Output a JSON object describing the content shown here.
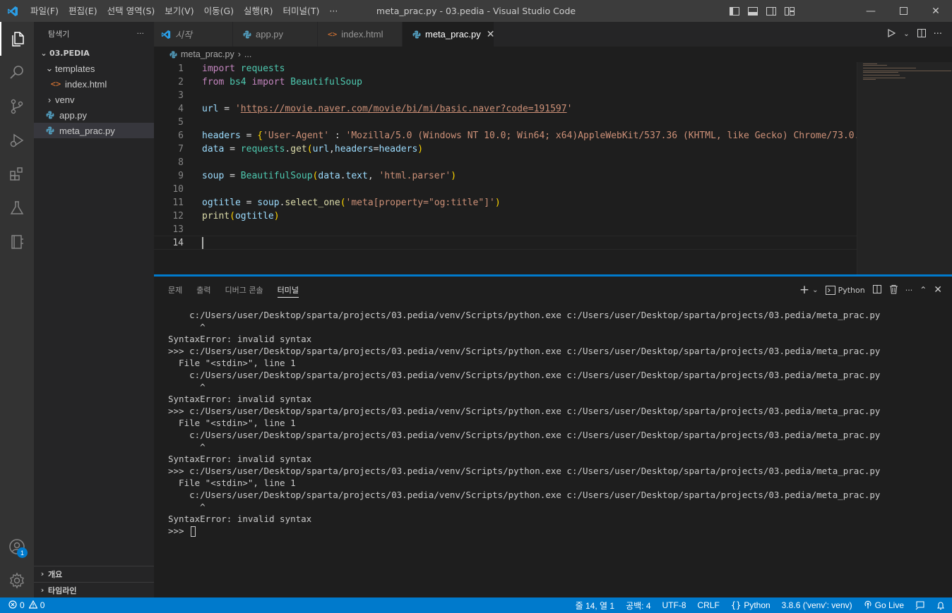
{
  "window": {
    "title": "meta_prac.py - 03.pedia - Visual Studio Code",
    "menu": [
      "파일(F)",
      "편집(E)",
      "선택 영역(S)",
      "보기(V)",
      "이동(G)",
      "실행(R)",
      "터미널(T)",
      "···"
    ]
  },
  "sidebar": {
    "header": "탐색기",
    "more": "···",
    "folder": "03.PEDIA",
    "tree": [
      {
        "label": "templates",
        "kind": "folder-open"
      },
      {
        "label": "index.html",
        "kind": "html"
      },
      {
        "label": "venv",
        "kind": "folder-closed"
      },
      {
        "label": "app.py",
        "kind": "python"
      },
      {
        "label": "meta_prac.py",
        "kind": "python",
        "selected": true
      }
    ],
    "outline": "개요",
    "timeline": "타임라인"
  },
  "tabs": [
    {
      "label": "시작",
      "icon": "vscode-icon"
    },
    {
      "label": "app.py",
      "icon": "python-icon"
    },
    {
      "label": "index.html",
      "icon": "html-icon"
    },
    {
      "label": "meta_prac.py",
      "icon": "python-icon",
      "active": true
    }
  ],
  "breadcrumb": {
    "file": "meta_prac.py",
    "sep": "›",
    "more": "..."
  },
  "editor": {
    "line_numbers": [
      "1",
      "2",
      "3",
      "4",
      "5",
      "6",
      "7",
      "8",
      "9",
      "10",
      "11",
      "12",
      "13",
      "14"
    ],
    "current_line": 14
  },
  "panel": {
    "tabs": [
      "문제",
      "출력",
      "디버그 콘솔",
      "터미널"
    ],
    "active_tab": "터미널",
    "shell": "Python",
    "terminal_lines": [
      "    c:/Users/user/Desktop/sparta/projects/03.pedia/venv/Scripts/python.exe c:/Users/user/Desktop/sparta/projects/03.pedia/meta_prac.py",
      "      ^",
      "SyntaxError: invalid syntax",
      ">>> c:/Users/user/Desktop/sparta/projects/03.pedia/venv/Scripts/python.exe c:/Users/user/Desktop/sparta/projects/03.pedia/meta_prac.py",
      "  File \"<stdin>\", line 1",
      "    c:/Users/user/Desktop/sparta/projects/03.pedia/venv/Scripts/python.exe c:/Users/user/Desktop/sparta/projects/03.pedia/meta_prac.py",
      "      ^",
      "SyntaxError: invalid syntax",
      ">>> c:/Users/user/Desktop/sparta/projects/03.pedia/venv/Scripts/python.exe c:/Users/user/Desktop/sparta/projects/03.pedia/meta_prac.py",
      "  File \"<stdin>\", line 1",
      "    c:/Users/user/Desktop/sparta/projects/03.pedia/venv/Scripts/python.exe c:/Users/user/Desktop/sparta/projects/03.pedia/meta_prac.py",
      "      ^",
      "SyntaxError: invalid syntax",
      ">>> c:/Users/user/Desktop/sparta/projects/03.pedia/venv/Scripts/python.exe c:/Users/user/Desktop/sparta/projects/03.pedia/meta_prac.py",
      "  File \"<stdin>\", line 1",
      "    c:/Users/user/Desktop/sparta/projects/03.pedia/venv/Scripts/python.exe c:/Users/user/Desktop/sparta/projects/03.pedia/meta_prac.py",
      "      ^",
      "SyntaxError: invalid syntax"
    ],
    "prompt": ">>> "
  },
  "statusbar": {
    "errors": "0",
    "warnings": "0",
    "position": "줄 14, 열 1",
    "spaces": "공백: 4",
    "encoding": "UTF-8",
    "eol": "CRLF",
    "language": "Python",
    "interpreter": "3.8.6 ('venv': venv)",
    "golive": "Go Live"
  },
  "accounts_badge": "1",
  "colors": {
    "accent": "#007acc",
    "titlebar": "#3c3c3c",
    "activitybar": "#333333",
    "sidebar": "#252526",
    "editor": "#1e1e1e"
  }
}
